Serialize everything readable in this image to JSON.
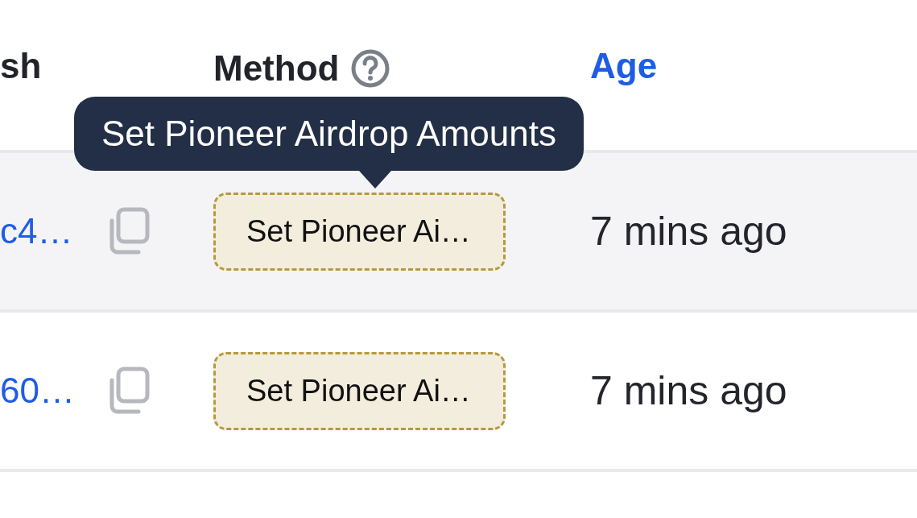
{
  "table": {
    "columns": [
      {
        "label": "sh",
        "active": false,
        "help": false
      },
      {
        "label": "Method",
        "active": false,
        "help": true
      },
      {
        "label": "Age",
        "active": true,
        "help": false
      }
    ],
    "rows": [
      {
        "hash": "c4…",
        "method": "Set Pioneer Ai…",
        "age": "7 mins ago",
        "tooltip": "Set Pioneer Airdrop Amounts"
      },
      {
        "hash": "60…",
        "method": "Set Pioneer Ai…",
        "age": "7 mins ago"
      }
    ]
  }
}
